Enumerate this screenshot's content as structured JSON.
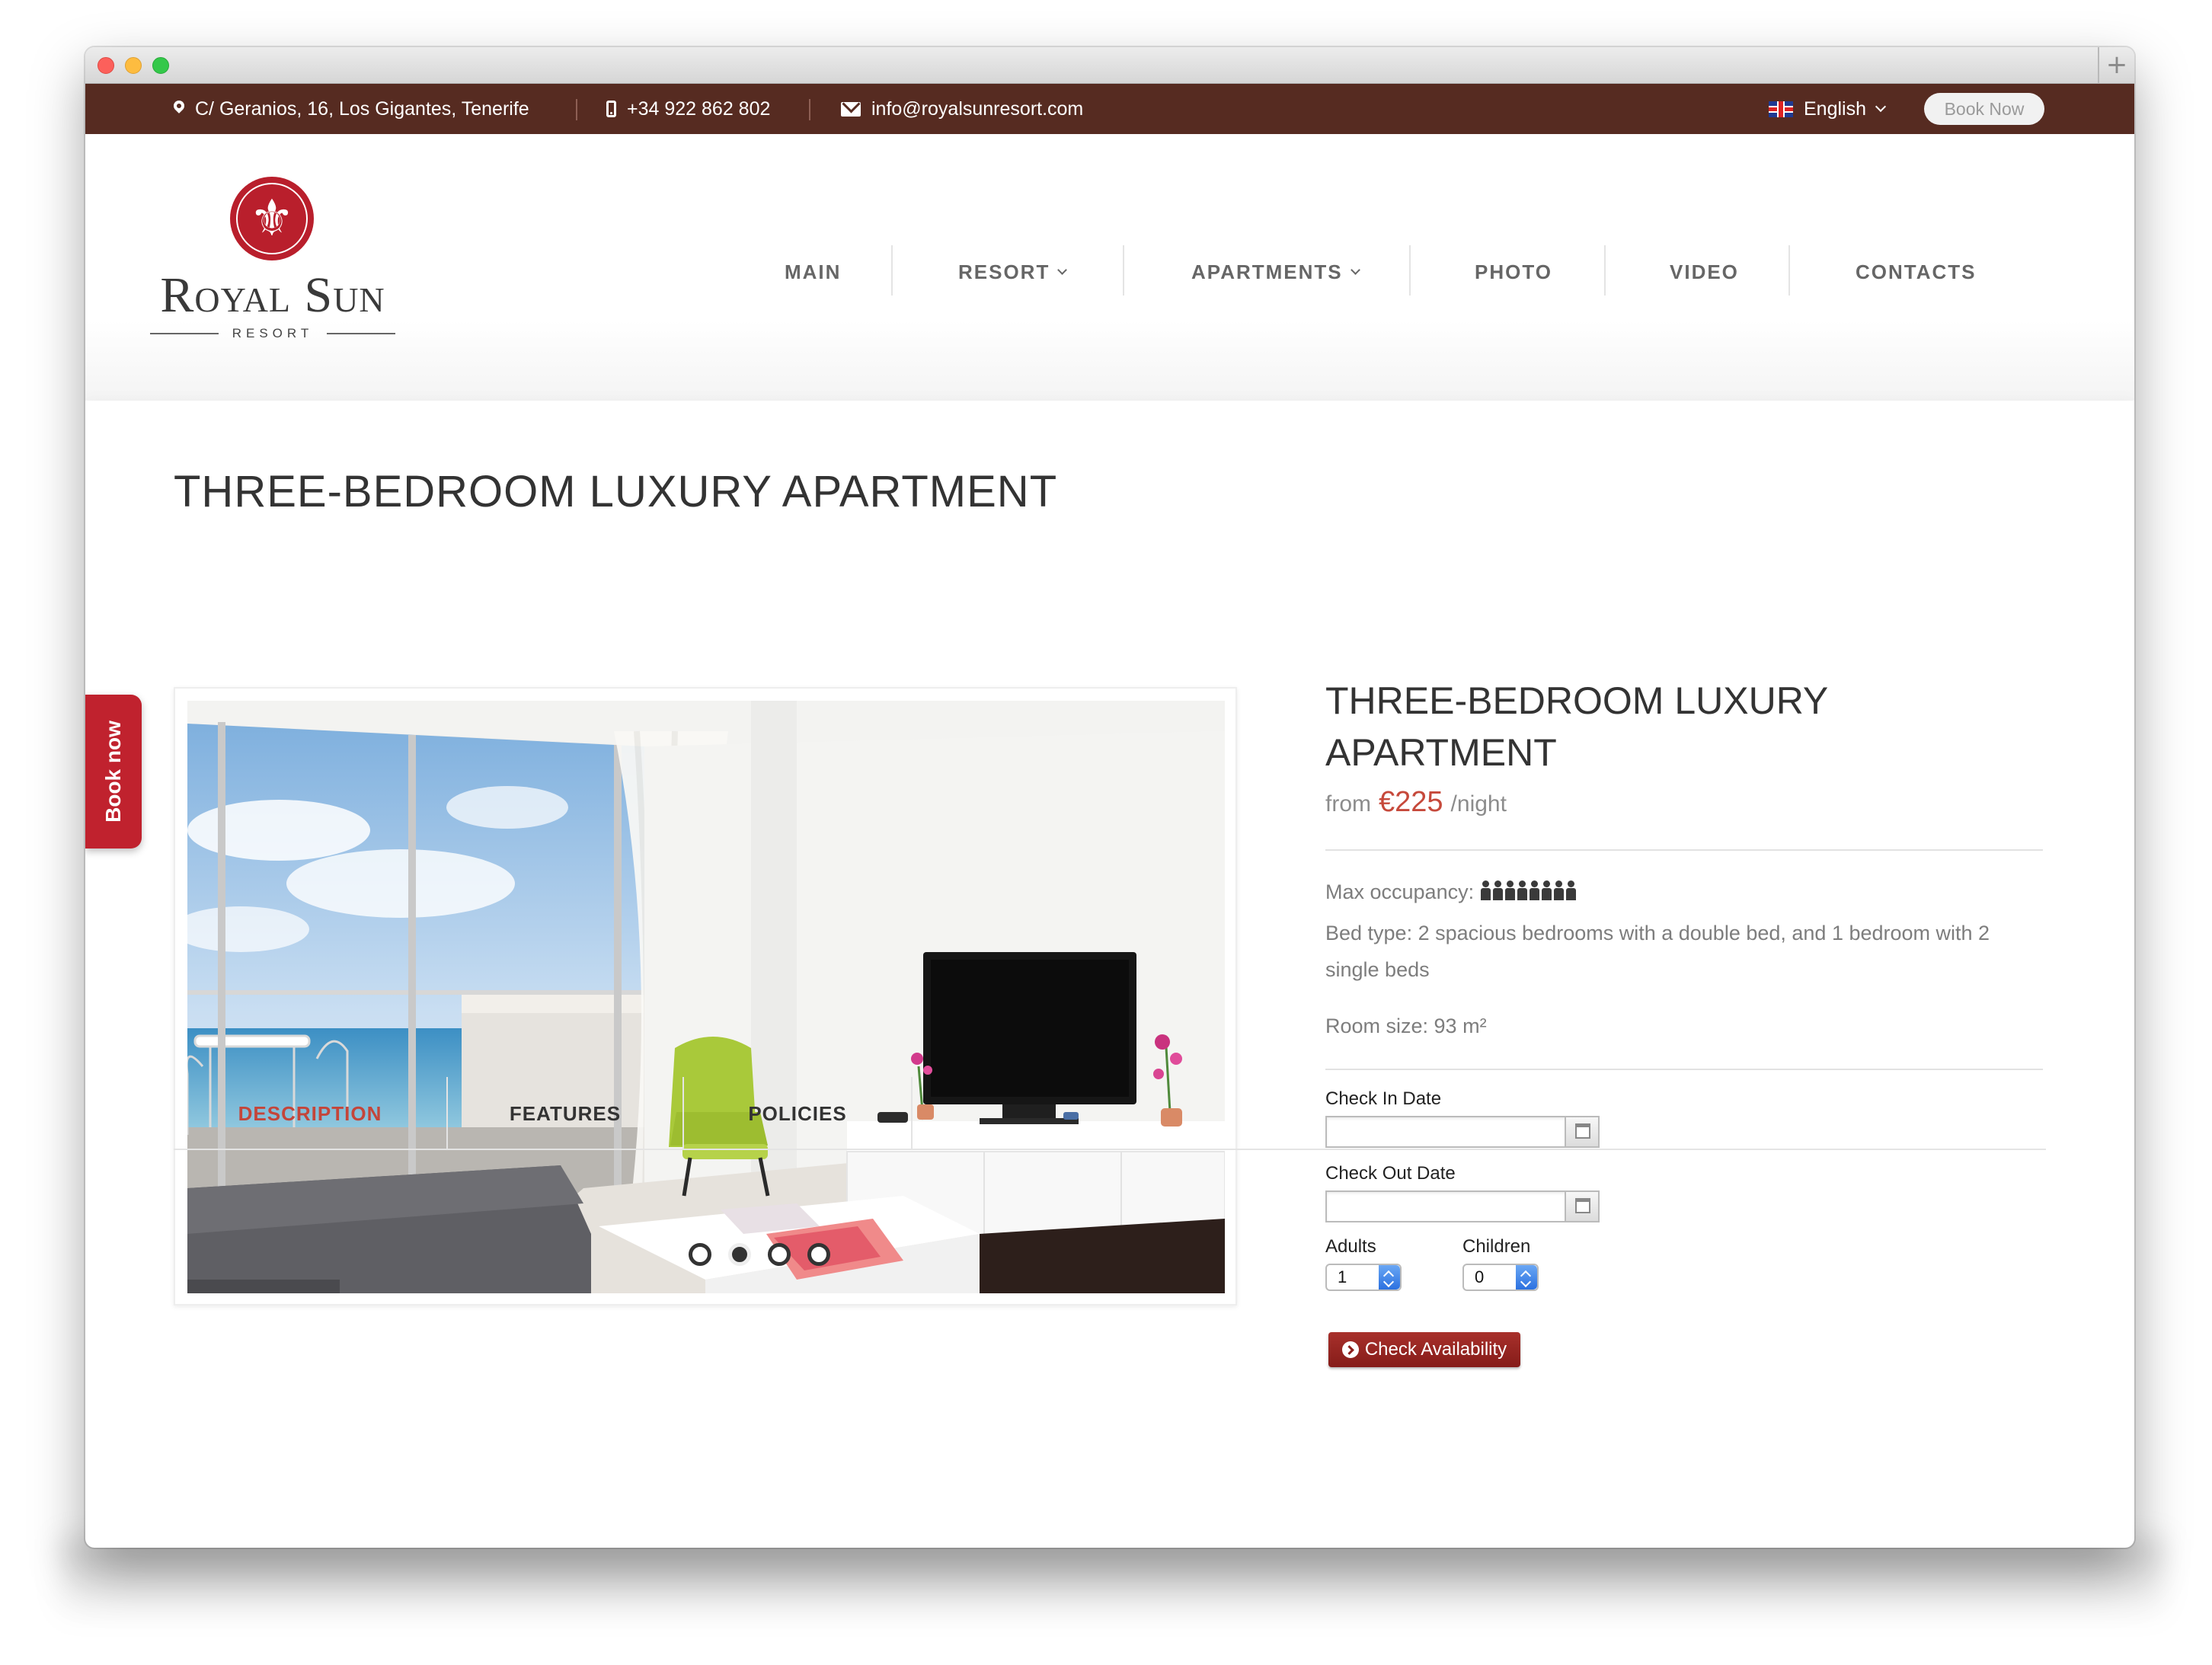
{
  "topbar": {
    "address": "C/ Geranios, 16, Los Gigantes, Tenerife",
    "phone": "+34 922 862 802",
    "email": "info@royalsunresort.com",
    "language": "English",
    "book_now": "Book Now"
  },
  "logo": {
    "name": "Royal Sun",
    "subtitle": "RESORT"
  },
  "nav": {
    "items": [
      {
        "label": "MAIN"
      },
      {
        "label": "RESORT"
      },
      {
        "label": "APARTMENTS"
      },
      {
        "label": "PHOTO"
      },
      {
        "label": "VIDEO"
      },
      {
        "label": "CONTACTS"
      }
    ]
  },
  "page": {
    "title": "THREE-BEDROOM LUXURY APARTMENT"
  },
  "side_tab": {
    "label": "Book now"
  },
  "gallery": {
    "slide_count": 4,
    "active_slide": 2
  },
  "room": {
    "title_line1": "THREE-BEDROOM LUXURY",
    "title_line2": "APARTMENT",
    "price_prefix": "from",
    "price": "€225",
    "price_suffix": "/night",
    "max_occupancy_label": "Max occupancy:",
    "max_occupancy": 8,
    "bed_type": "Bed type: 2 spacious bedrooms with a double bed, and 1 bedroom with 2 single beds",
    "room_size": "Room size: 93 m²"
  },
  "form": {
    "check_in_label": "Check In Date",
    "check_in_value": "",
    "check_out_label": "Check Out Date",
    "check_out_value": "",
    "adults_label": "Adults",
    "adults_value": "1",
    "children_label": "Children",
    "children_value": "0",
    "submit_label": "Check Availability"
  },
  "tabs": [
    {
      "label": "DESCRIPTION"
    },
    {
      "label": "FEATURES"
    },
    {
      "label": "POLICIES"
    }
  ],
  "colors": {
    "topbar": "#562b21",
    "accent": "#c4453a",
    "side_tab": "#c0222e",
    "check_button": "#851c19"
  }
}
